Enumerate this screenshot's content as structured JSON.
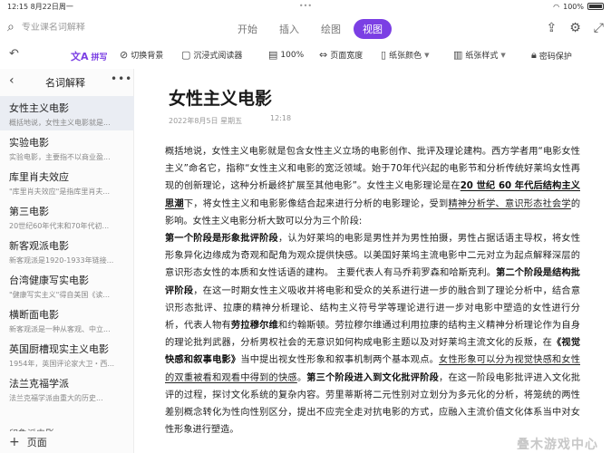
{
  "status": {
    "time_date": "12:15  8月22日周一",
    "center": "•••",
    "battery": "100%"
  },
  "top": {
    "search_placeholder": "专业课名词解释",
    "tabs": [
      {
        "label": "开始",
        "active": false
      },
      {
        "label": "插入",
        "active": false
      },
      {
        "label": "绘图",
        "active": false
      },
      {
        "label": "视图",
        "active": true
      }
    ],
    "accent_color": "#7b3fe4"
  },
  "toolbar": {
    "pinyin": "拼写",
    "change_bg": "切换背景",
    "immersive": "沉浸式阅读器",
    "zoom": "100%",
    "page_width": "页面宽度",
    "paper_color": "纸张颜色",
    "paper_style": "纸张样式",
    "password": "密码保护"
  },
  "sidebar": {
    "title": "名词解释",
    "items": [
      {
        "title": "女性主义电影",
        "sub": "概括地说，女性主义电影就是..."
      },
      {
        "title": "实验电影",
        "sub": "实验电影，主要指不以商业盈..."
      },
      {
        "title": "库里肖夫效应",
        "sub": "\"库里肖夫效应\"是指库里肖夫..."
      },
      {
        "title": "第三电影",
        "sub": "20世纪60年代末和70年代初..."
      },
      {
        "title": "新客观派电影",
        "sub": "新客观派是1920-1933年链接..."
      },
      {
        "title": "台湾健康写实电影",
        "sub": "\"健康写实主义\"得自美国《读..."
      },
      {
        "title": "横断面电影",
        "sub": "新客观派是一种从客观、中立..."
      },
      {
        "title": "英国厨槽现实主义电影",
        "sub": "1954年，英国评论家大卫・西..."
      },
      {
        "title": "法兰克福学派",
        "sub": "法兰克福学派由重大的历史..."
      }
    ],
    "partial": "印象派电影",
    "add_page": "页面"
  },
  "doc": {
    "title": "女性主义电影",
    "date": "2022年8月5日 星期五",
    "time": "12:18",
    "p1_a": "概括地说，女性主义电影就是包含女性主义立场的电影创作、批评及理论建构。西方学者用“电影女性主义”命名它，指称“女性主义和电影的宽泛领域。始于70年代兴起的电影节和分析传统好莱坞女性再现的创新理论，这种分析最终扩展至其他电影”。女性主义电影理论是在",
    "p1_b": "20 世纪 60 年代后结构主义思潮",
    "p1_c": "下，将女性主义和电影影像结合起来进行分析的电影理论，受到",
    "p1_d": "精神分析学、意识形态社会学",
    "p1_e": "的影响。女性主义电影分析大致可以分为三个阶段:",
    "p2_a": "第一个阶段是形象批评阶段",
    "p2_b": "，认为好莱坞的电影是男性并为男性拍摄，男性占据话语主导权，将女性形象异化边缘成为奇观和配角为观众提供快感。以美国好莱坞主流电影中二元对立为起点解释深层的意识形态女性的本质和女性话语的建构。 主要代表人有马乔莉罗森和哈斯克利。",
    "p2_c": "第二个阶段是结构批评阶段",
    "p2_d": "，在这一时期女性主义吸收并将电影和受众的关系进行进一步的融合到了理论分析中，结合意识形态批评、拉康的精神分析理论、结构主义符号学等理论进行进一步对电影中塑造的女性进行分析，代表人物有",
    "p2_e": "劳拉穆尔维",
    "p2_f": "和约翰斯顿。劳拉穆尔维通过利用拉康的结构主义精神分析理论作为自身的理论批判武器，分析男权社会的无意识如何构成电影主题以及对好莱坞主流文化的反叛，在",
    "p2_g": "《视觉快感和叙事电影》",
    "p2_h": "当中提出视女性形象和叙事机制两个基本观点。",
    "p2_i": "女性形象可以分为视觉快感和女性的双重被看和观看中得到的快感",
    "p2_j": "。",
    "p2_k": "第三个阶段进入到文化批评阶段",
    "p2_l": "，在这一阶段电影批评进入文化批评的过程，探讨文化系统的复杂内容。劳里蒂斯将二元性别对立划分为多元化的分析，将笼统的两性差别概念转化为性向性别区分，提出不应完全走对抗电影的方式，应融入主流价值文化体系当中对女性形象进行塑造。"
  },
  "watermark": "叠木游戏中心"
}
